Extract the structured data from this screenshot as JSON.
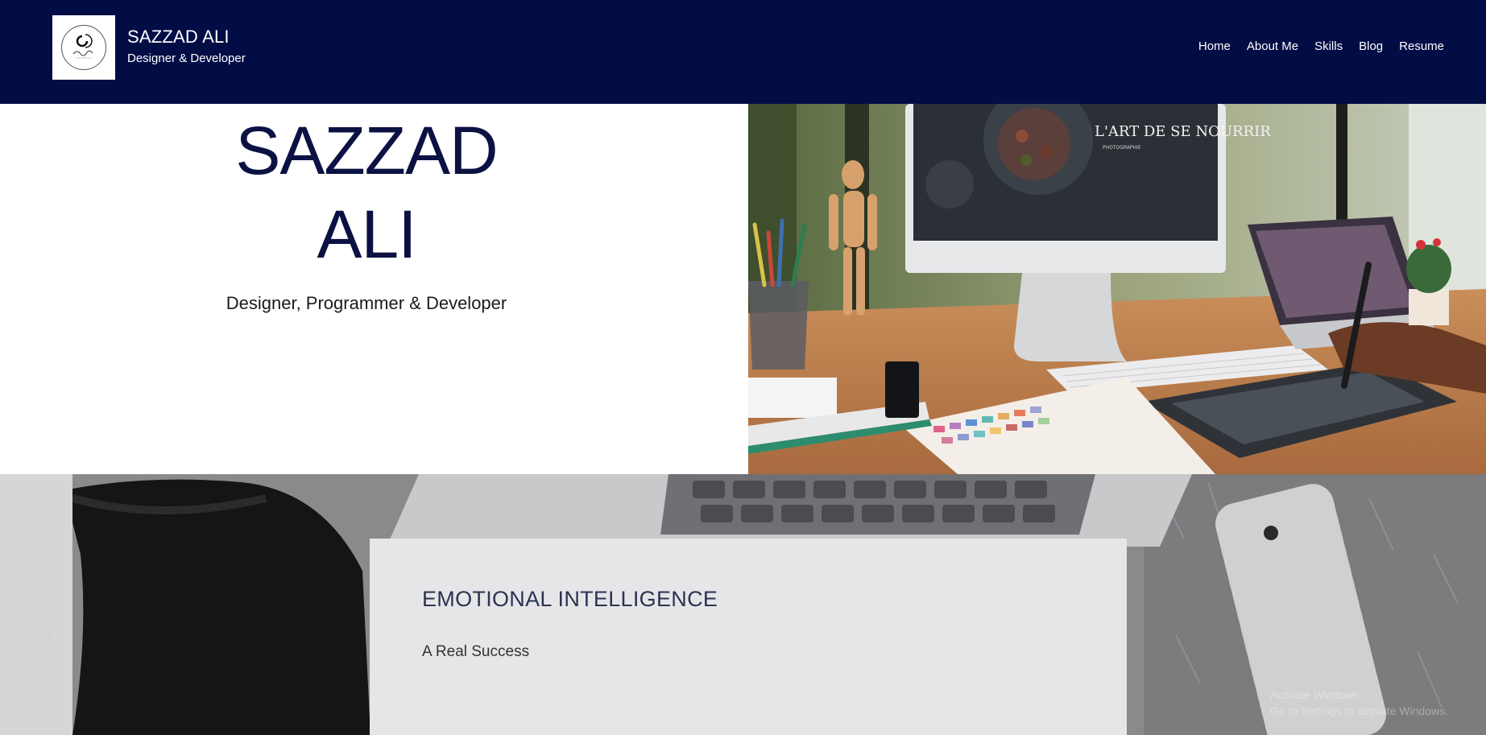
{
  "header": {
    "site_title": "SAZZAD ALI",
    "tagline": "Designer & Developer",
    "logo_alt": "Sazzad Ali logo",
    "nav": [
      {
        "label": "Home"
      },
      {
        "label": "About Me"
      },
      {
        "label": "Skills"
      },
      {
        "label": "Blog"
      },
      {
        "label": "Resume"
      }
    ]
  },
  "hero": {
    "name_line1": "SAZZAD",
    "name_line2": "ALI",
    "subtitle": "Designer, Programmer & Developer",
    "screen_heading": "L'ART DE SE NOURRIR",
    "screen_sub": "PHOTOGRAPHIE"
  },
  "feature": {
    "title": "EMOTIONAL INTELLIGENCE",
    "subtitle": "A Real Success",
    "watermark_line1": "Activate Windows",
    "watermark_line2": "Go to Settings to activate Windows."
  },
  "colors": {
    "header_bg": "#020c45",
    "accent_navy": "#0b1243",
    "card_bg": "#e6e6e9"
  }
}
